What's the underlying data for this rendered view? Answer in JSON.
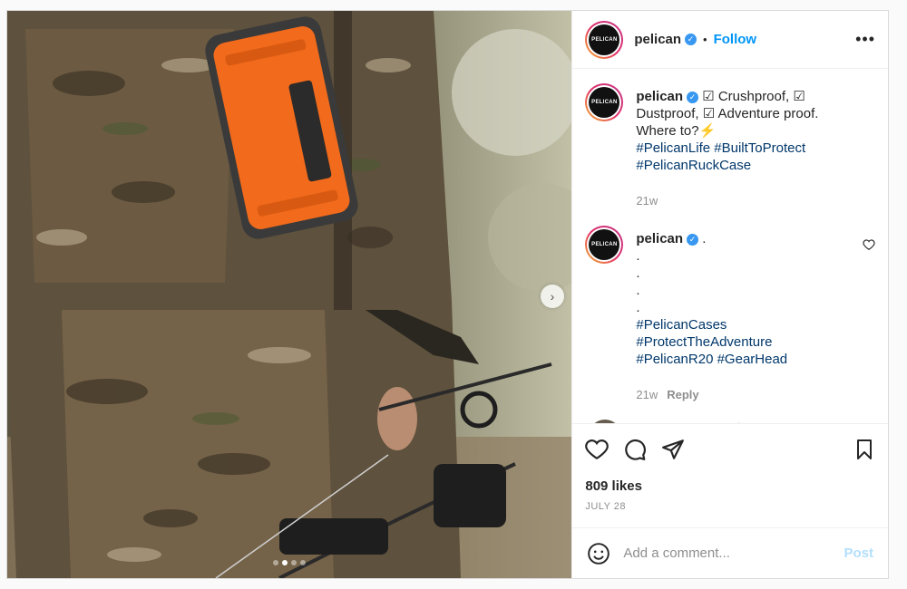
{
  "post": {
    "author": "pelican",
    "avatar_text": "PELICAN",
    "follow_label": "Follow",
    "separator": "•",
    "more_label": "•••"
  },
  "carousel": {
    "total": 4,
    "active_index": 1,
    "next_icon": "chevron-right-icon"
  },
  "comments": [
    {
      "user": "pelican",
      "text_plain": "☑ Crushproof, ☑ Dustproof, ☑ Adventure proof. Where to?⚡",
      "tags": [
        "#PelicanLife",
        "#BuiltToProtect",
        "#PelicanRuckCase"
      ],
      "time": "21w"
    },
    {
      "user": "pelican",
      "lines": [
        ".",
        ".",
        ".",
        ".",
        "."
      ],
      "tags": [
        "#PelicanCases",
        "#ProtectTheAdventure",
        "#PelicanR20",
        "#GearHead"
      ],
      "time": "21w",
      "reply": "Reply"
    },
    {
      "user": "kodastacoma",
      "text_plain": "👏"
    }
  ],
  "actions": {
    "icons": [
      "heart-icon",
      "comment-icon",
      "share-icon",
      "bookmark-icon"
    ],
    "likes": "809 likes",
    "date": "JULY 28"
  },
  "composer": {
    "placeholder": "Add a comment...",
    "post_label": "Post",
    "emoji_icon": "smiley-icon"
  },
  "colors": {
    "link": "#0095f6",
    "hashtag": "#00376b",
    "verified": "#3897f0",
    "case_orange": "#f26a1b"
  }
}
